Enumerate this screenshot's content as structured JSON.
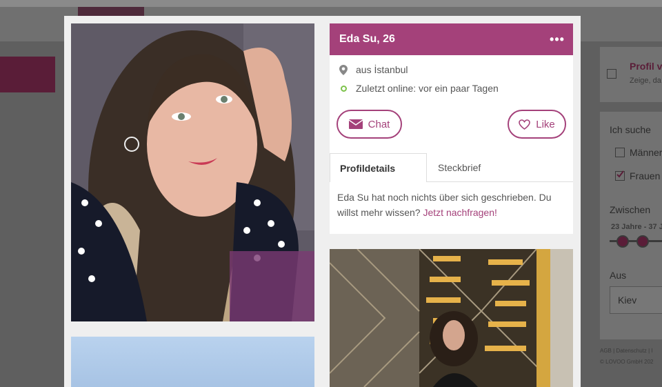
{
  "profile": {
    "title": "Eda Su, 26",
    "location": "aus İstanbul",
    "online_status": "Zuletzt online: vor ein paar Tagen",
    "chat_label": "Chat",
    "like_label": "Like",
    "more_label": "•••"
  },
  "tabs": {
    "active": "Profildetails",
    "inactive": "Steckbrief"
  },
  "description": {
    "text": "Eda Su hat noch nichts über sich geschrieben. Du willst mehr wissen? ",
    "link": "Jetzt nachfragen!"
  },
  "background": {
    "profile_heading": "Profil v",
    "profile_sub": "Zeige, da",
    "search_label": "Ich suche",
    "option_men": "Männer",
    "option_women": "Frauen",
    "between_label": "Zwischen",
    "age_range": "23 Jahre - 37 J",
    "from_label": "Aus",
    "city_value": "Kiev",
    "footer_links": "AGB | Datenschutz | I",
    "copyright": "© LOVOO GmbH 202"
  },
  "colors": {
    "accent": "#a4417a",
    "online": "#7cc24a"
  }
}
